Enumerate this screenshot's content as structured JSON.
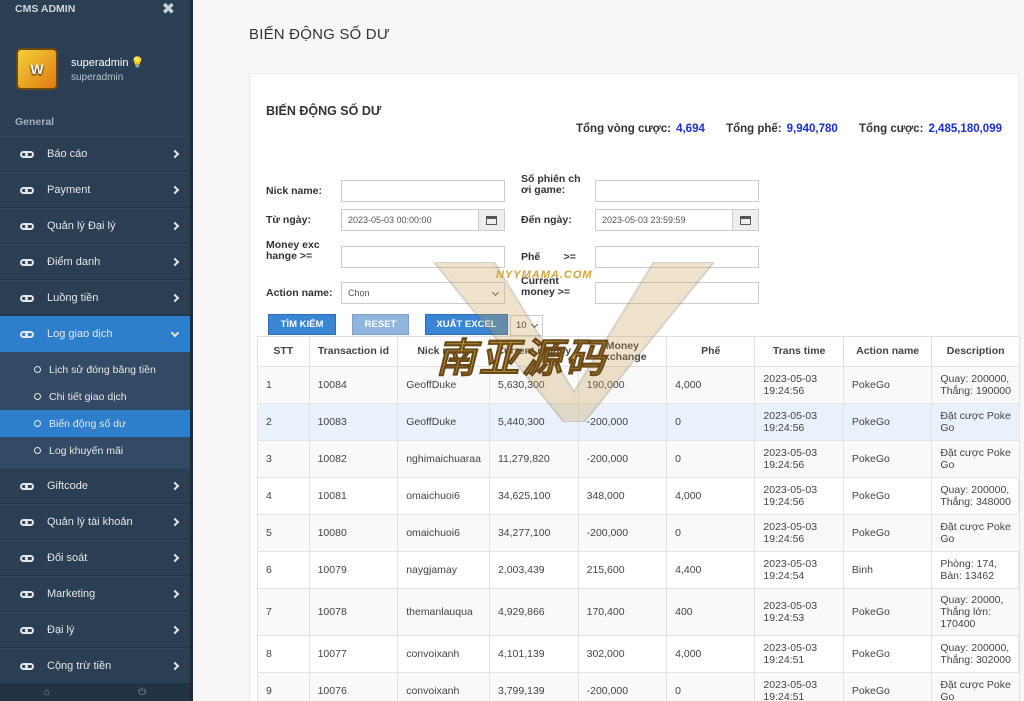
{
  "sidebar": {
    "brand": "CMS ADMIN",
    "profile": {
      "name": "superadmin",
      "sub": "superadmin",
      "avatar_text": "W"
    },
    "section": "General",
    "items": [
      {
        "label": "Báo cáo"
      },
      {
        "label": "Payment"
      },
      {
        "label": "Quản lý Đại lý"
      },
      {
        "label": "Điểm danh"
      },
      {
        "label": "Luồng tiền"
      },
      {
        "label": "Log giao dịch"
      },
      {
        "label": "Giftcode"
      },
      {
        "label": "Quản lý tài khoản"
      },
      {
        "label": "Đối soát"
      },
      {
        "label": "Marketing"
      },
      {
        "label": "Đại lý"
      },
      {
        "label": "Cộng trừ tiền"
      }
    ],
    "subitems": [
      {
        "label": "Lịch sử đóng băng tiền"
      },
      {
        "label": "Chi tiết giao dịch"
      },
      {
        "label": "Biến động số dư"
      },
      {
        "label": "Log khuyến mãi"
      }
    ]
  },
  "page": {
    "title": "BIẾN ĐỘNG SỐ DƯ"
  },
  "panel": {
    "title": "BIẾN ĐỘNG SỐ DƯ",
    "totals": {
      "vong_cuoc_label": "Tổng vòng cược:",
      "vong_cuoc": "4,694",
      "phe_label": "Tổng phế:",
      "phe": "9,940,780",
      "cuoc_label": "Tổng cược:",
      "cuoc": "2,485,180,099"
    }
  },
  "filters": {
    "nick_label": "Nick name:",
    "so_phien_label_1": "Số phiên ch",
    "so_phien_label_2": "ơi game:",
    "from_label": "Từ ngày:",
    "from_value": "2023-05-03 00:00:00",
    "to_label": "Đến ngày:",
    "to_value": "2023-05-03 23:59:59",
    "money_label_1": "Money exc",
    "money_label_2": "hange  >=",
    "phe_label": "Phế        >=",
    "action_label": "Action name:",
    "action_value": "Chọn",
    "current_label_1": "Current",
    "current_label_2": "money   >="
  },
  "buttons": {
    "search": "TÌM KIẾM",
    "reset": "RESET",
    "excel": "XUẤT EXCEL",
    "page_size": "10"
  },
  "watermark": {
    "text": "南亚源码",
    "url": "NYYMAMA.COM"
  },
  "table": {
    "headers": [
      "STT",
      "Transaction id",
      "Nick name",
      "Current money",
      "Money exchange",
      "Phế",
      "Trans time",
      "Action name",
      "Description"
    ],
    "rows": [
      {
        "stt": "1",
        "tid": "10084",
        "nick": "GeoffDuke",
        "current": "5,630,300",
        "exchange": "190,000",
        "phe": "4,000",
        "time": "2023-05-03 19:24:56",
        "action": "PokeGo",
        "desc": "Quay: 200000, Thắng: 190000"
      },
      {
        "stt": "2",
        "tid": "10083",
        "nick": "GeoffDuke",
        "current": "5,440,300",
        "exchange": "-200,000",
        "phe": "0",
        "time": "2023-05-03 19:24:56",
        "action": "PokeGo",
        "desc": "Đặt cược Poke Go"
      },
      {
        "stt": "3",
        "tid": "10082",
        "nick": "nghimaichuaraa",
        "current": "11,279,820",
        "exchange": "-200,000",
        "phe": "0",
        "time": "2023-05-03 19:24:56",
        "action": "PokeGo",
        "desc": "Đặt cược Poke Go"
      },
      {
        "stt": "4",
        "tid": "10081",
        "nick": "omaichuoi6",
        "current": "34,625,100",
        "exchange": "348,000",
        "phe": "4,000",
        "time": "2023-05-03 19:24:56",
        "action": "PokeGo",
        "desc": "Quay: 200000, Thắng: 348000"
      },
      {
        "stt": "5",
        "tid": "10080",
        "nick": "omaichuoi6",
        "current": "34,277,100",
        "exchange": "-200,000",
        "phe": "0",
        "time": "2023-05-03 19:24:56",
        "action": "PokeGo",
        "desc": "Đặt cược Poke Go"
      },
      {
        "stt": "6",
        "tid": "10079",
        "nick": "naygjamay",
        "current": "2,003,439",
        "exchange": "215,600",
        "phe": "4,400",
        "time": "2023-05-03 19:24:54",
        "action": "Binh",
        "desc": "Phòng: 174, Bàn: 13462"
      },
      {
        "stt": "7",
        "tid": "10078",
        "nick": "themanlauqua",
        "current": "4,929,866",
        "exchange": "170,400",
        "phe": "400",
        "time": "2023-05-03 19:24:53",
        "action": "PokeGo",
        "desc": "Quay: 20000, Thắng lớn: 170400"
      },
      {
        "stt": "8",
        "tid": "10077",
        "nick": "convoixanh",
        "current": "4,101,139",
        "exchange": "302,000",
        "phe": "4,000",
        "time": "2023-05-03 19:24:51",
        "action": "PokeGo",
        "desc": "Quay: 200000, Thắng: 302000"
      },
      {
        "stt": "9",
        "tid": "10076",
        "nick": "convoixanh",
        "current": "3,799,139",
        "exchange": "-200,000",
        "phe": "0",
        "time": "2023-05-03 19:24:51",
        "action": "PokeGo",
        "desc": "Đặt cược Poke Go"
      }
    ]
  }
}
